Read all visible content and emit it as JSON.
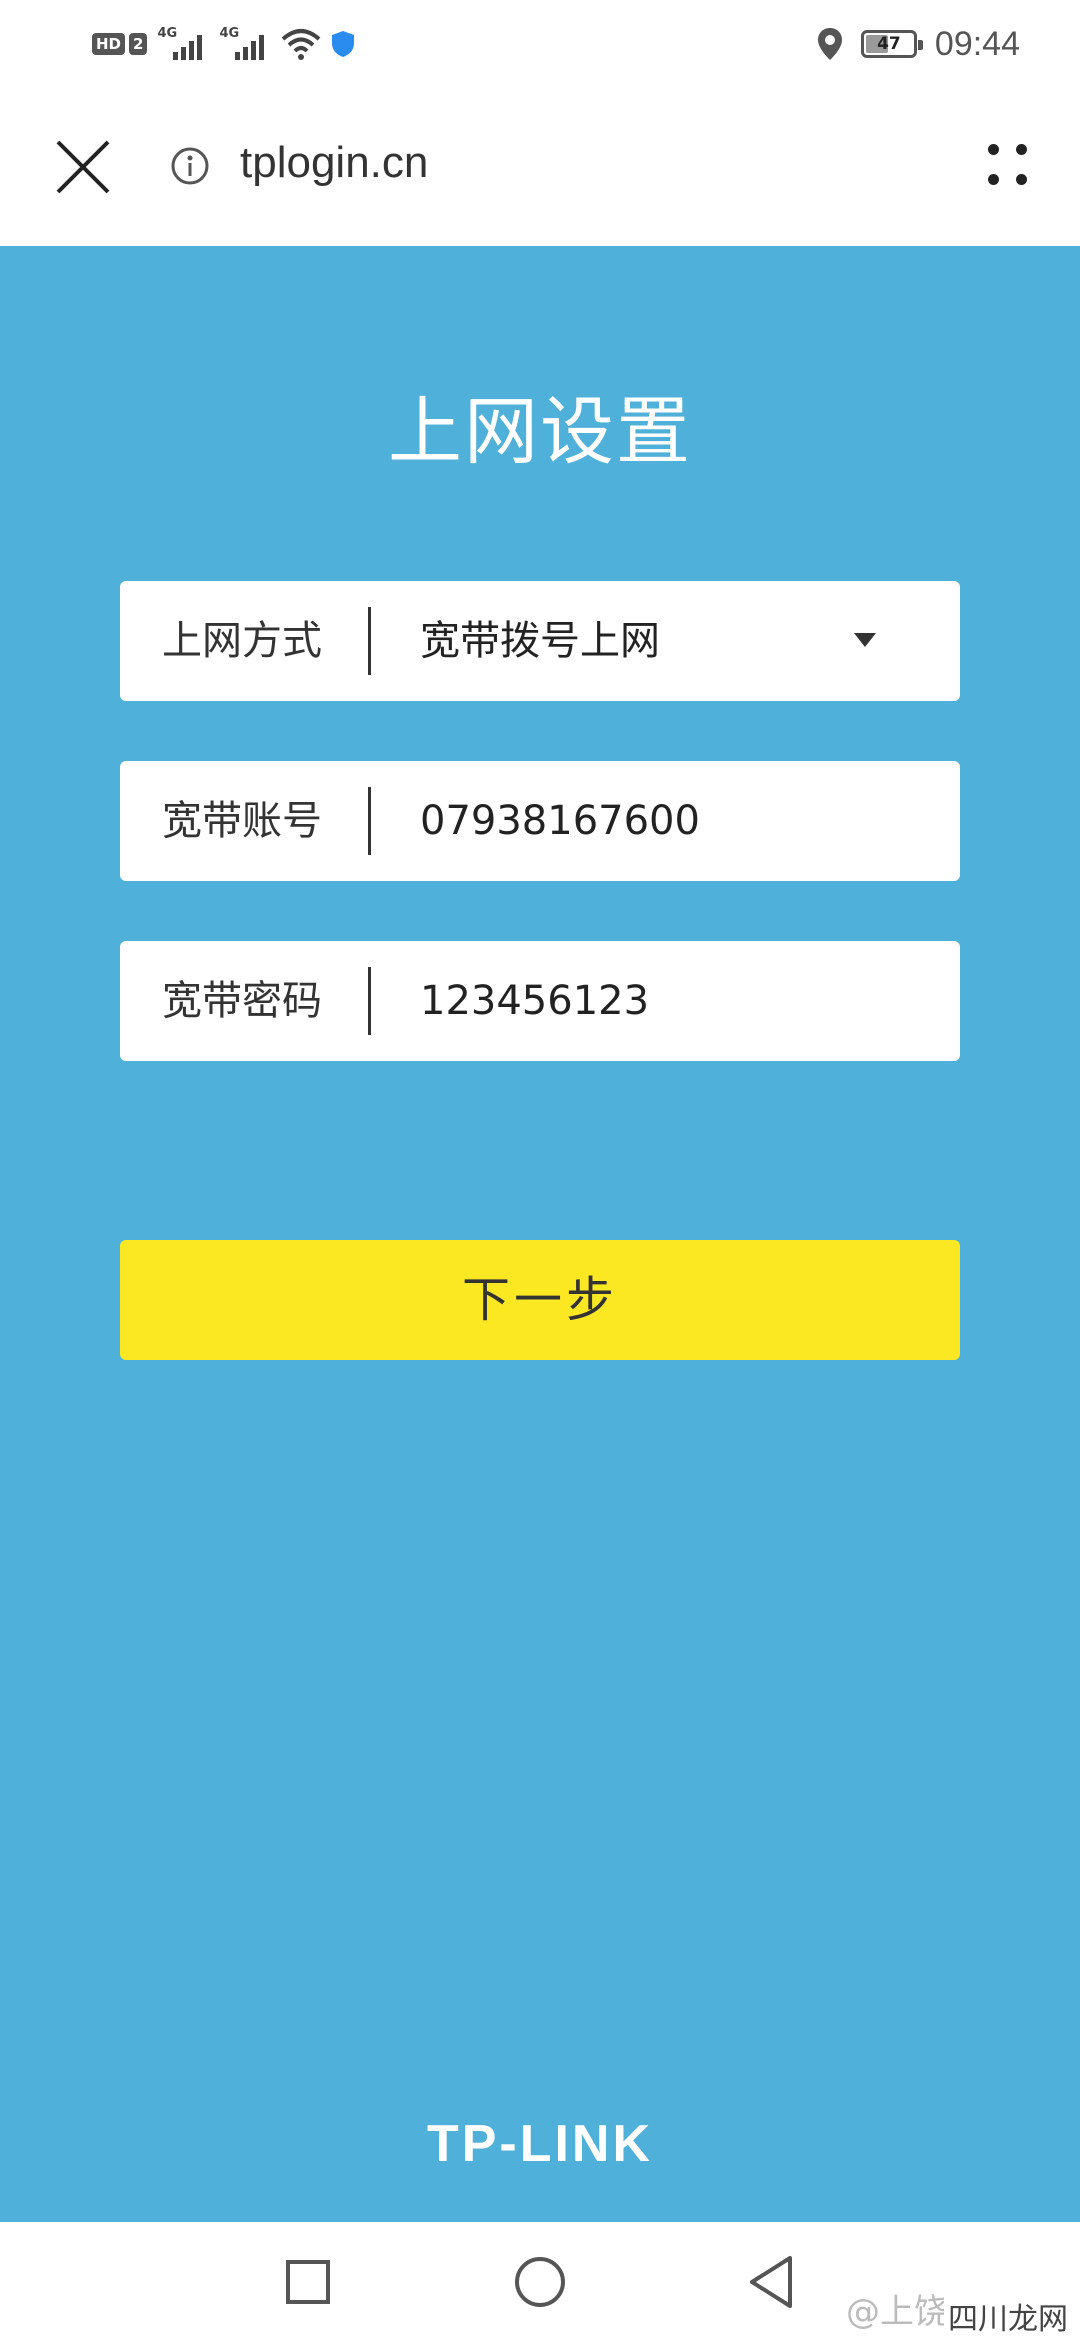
{
  "status_bar": {
    "hd_label": "HD",
    "sim_number": "2",
    "network_type_1": "4G",
    "network_type_2": "4G",
    "battery_level": "47",
    "time": "09:44",
    "icons": [
      "hd-icon",
      "signal-icon",
      "signal-icon",
      "wifi-icon",
      "shield-icon",
      "location-icon",
      "battery-icon"
    ]
  },
  "browser": {
    "url": "tplogin.cn",
    "icons": [
      "close-icon",
      "info-icon",
      "more-dots-icon"
    ]
  },
  "page": {
    "title": "上网设置",
    "fields": [
      {
        "label": "上网方式",
        "value": "宽带拨号上网"
      },
      {
        "label": "宽带账号",
        "value": "07938167600"
      },
      {
        "label": "宽带密码",
        "value": "123456123"
      }
    ],
    "next_button": "下一步",
    "brand": "TP-LINK",
    "colors": {
      "background": "#4fb0d9",
      "button": "#fbe823",
      "field": "#ffffff"
    }
  },
  "nav_bar": {
    "icons": [
      "recent-apps-icon",
      "home-icon",
      "back-icon"
    ],
    "watermark": "@上饶市陆哥",
    "watermark_site": "四川龙网"
  }
}
